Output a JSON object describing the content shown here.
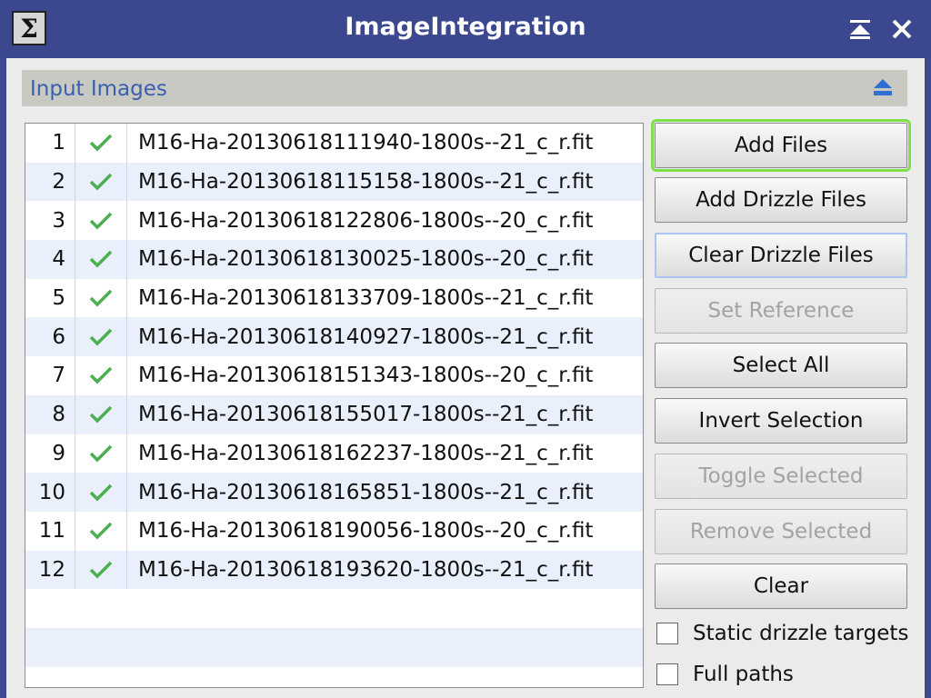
{
  "window": {
    "title": "ImageIntegration",
    "menu_icon": "Σ"
  },
  "titlebar_icons": {
    "shade": "shade-icon",
    "close": "close-icon"
  },
  "section": {
    "title": "Input Images",
    "collapse_icon": "collapse-up-icon"
  },
  "list": {
    "rows": [
      {
        "index": "1",
        "enabled": true,
        "name": "M16-Ha-20130618111940-1800s--21_c_r.fit"
      },
      {
        "index": "2",
        "enabled": true,
        "name": "M16-Ha-20130618115158-1800s--21_c_r.fit"
      },
      {
        "index": "3",
        "enabled": true,
        "name": "M16-Ha-20130618122806-1800s--20_c_r.fit"
      },
      {
        "index": "4",
        "enabled": true,
        "name": "M16-Ha-20130618130025-1800s--20_c_r.fit"
      },
      {
        "index": "5",
        "enabled": true,
        "name": "M16-Ha-20130618133709-1800s--21_c_r.fit"
      },
      {
        "index": "6",
        "enabled": true,
        "name": "M16-Ha-20130618140927-1800s--21_c_r.fit"
      },
      {
        "index": "7",
        "enabled": true,
        "name": "M16-Ha-20130618151343-1800s--20_c_r.fit"
      },
      {
        "index": "8",
        "enabled": true,
        "name": "M16-Ha-20130618155017-1800s--21_c_r.fit"
      },
      {
        "index": "9",
        "enabled": true,
        "name": "M16-Ha-20130618162237-1800s--21_c_r.fit"
      },
      {
        "index": "10",
        "enabled": true,
        "name": "M16-Ha-20130618165851-1800s--21_c_r.fit"
      },
      {
        "index": "11",
        "enabled": true,
        "name": "M16-Ha-20130618190056-1800s--20_c_r.fit"
      },
      {
        "index": "12",
        "enabled": true,
        "name": "M16-Ha-20130618193620-1800s--21_c_r.fit"
      }
    ]
  },
  "buttons": {
    "add_files": "Add Files",
    "add_drizzle_files": "Add Drizzle Files",
    "clear_drizzle_files": "Clear Drizzle Files",
    "set_reference": "Set Reference",
    "select_all": "Select All",
    "invert_selection": "Invert Selection",
    "toggle_selected": "Toggle Selected",
    "remove_selected": "Remove Selected",
    "clear": "Clear"
  },
  "options": {
    "static_drizzle_targets": {
      "label": "Static drizzle targets",
      "checked": false
    },
    "full_paths": {
      "label": "Full paths",
      "checked": false
    }
  },
  "colors": {
    "titlebar": "#3b4890",
    "section_title": "#3b5fb0",
    "checkmark": "#4caf50",
    "highlight": "#7de04a"
  }
}
